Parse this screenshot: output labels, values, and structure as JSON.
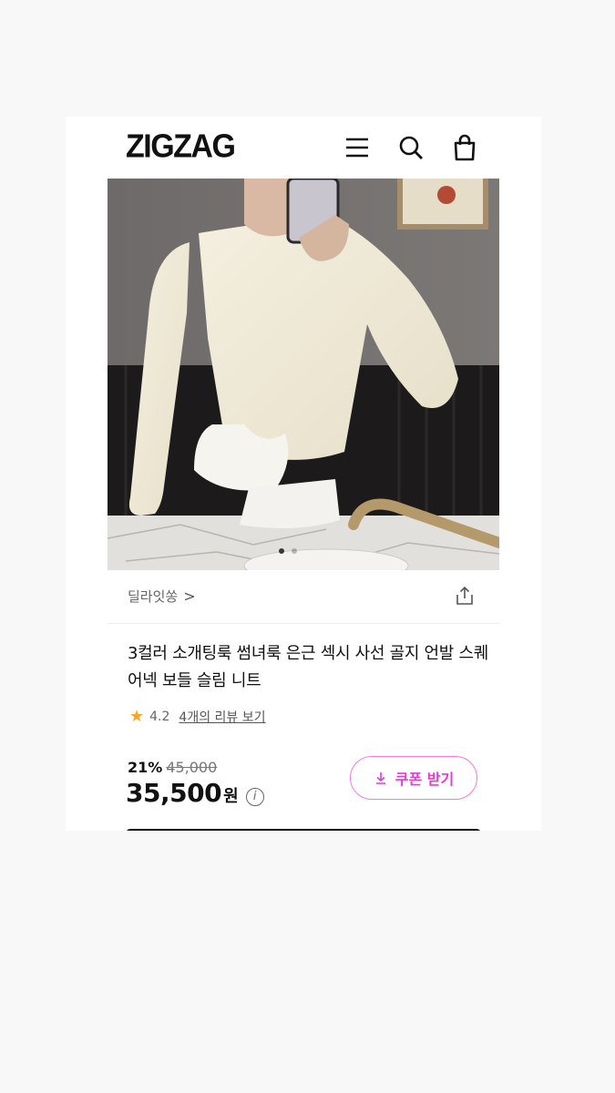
{
  "app": {
    "logo": "ZIGZAG"
  },
  "header": {
    "icons": [
      "menu-icon",
      "search-icon",
      "cart-icon"
    ]
  },
  "product": {
    "seller": "딜라잇쏭",
    "seller_chevron": ">",
    "title": "3컬러 소개팅룩 썸녀룩 은근 섹시 사선 골지 언발 스퀘어넥 보들 슬림 니트",
    "rating": "4.2",
    "review_link": "4개의 리뷰 보기",
    "discount": "21%",
    "original_price": "45,000",
    "price": "35,500",
    "currency": "원",
    "info_glyph": "i",
    "coupon_label": "쿠폰 받기",
    "image_page": 1,
    "image_count": 2
  },
  "colors": {
    "accent": "#e43ad7",
    "accent_border": "#f07be4",
    "star": "#f5a623"
  }
}
